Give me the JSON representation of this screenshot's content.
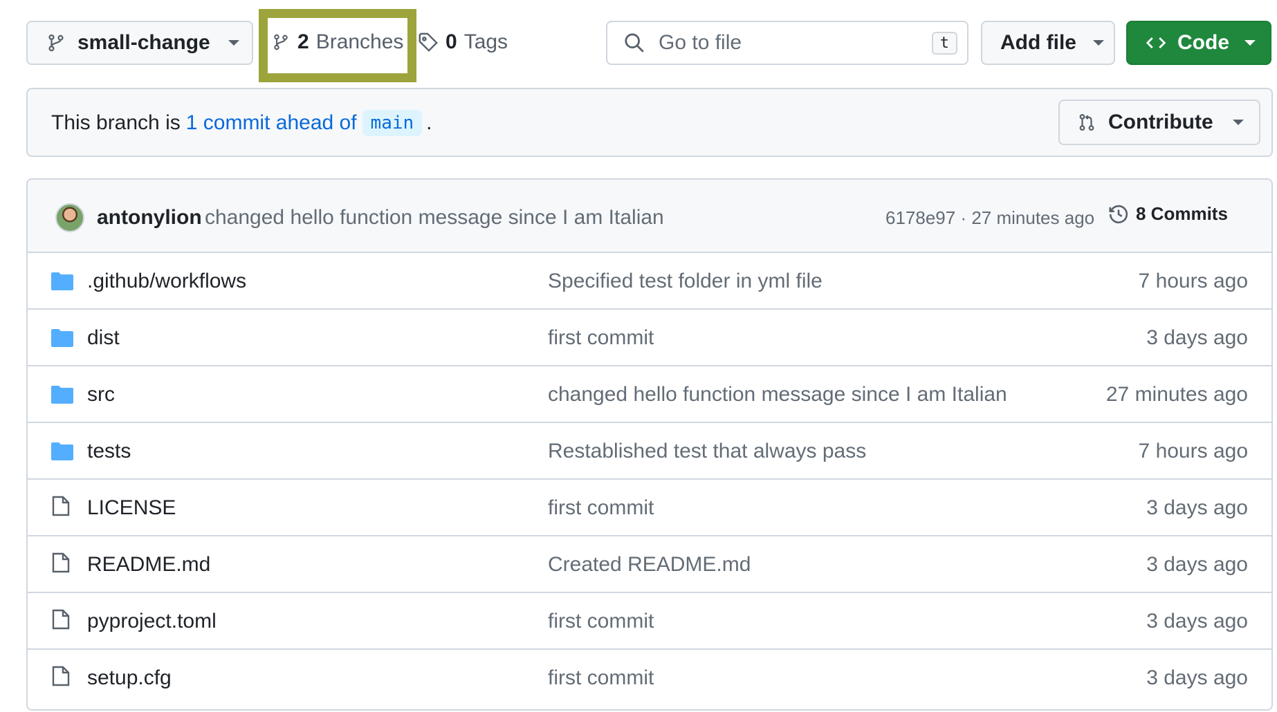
{
  "toolbar": {
    "branch_name": "small-change",
    "branches_count": "2",
    "branches_label": "Branches",
    "tags_count": "0",
    "tags_label": "Tags",
    "goto_placeholder": "Go to file",
    "goto_shortcut": "t",
    "add_file_label": "Add file",
    "code_label": "Code"
  },
  "banner": {
    "prefix": "This branch is",
    "link_text": "1 commit ahead of",
    "base_branch": "main",
    "suffix": ".",
    "contribute_label": "Contribute"
  },
  "latest_commit": {
    "author": "antonylion",
    "message": "changed hello function message since I am Italian",
    "meta": "6178e97 · 27 minutes ago",
    "commits_label": "8 Commits"
  },
  "files": [
    {
      "name": ".github/workflows",
      "type": "folder",
      "message": "Specified test folder in yml file",
      "time": "7 hours ago"
    },
    {
      "name": "dist",
      "type": "folder",
      "message": "first commit",
      "time": "3 days ago"
    },
    {
      "name": "src",
      "type": "folder",
      "message": "changed hello function message since I am Italian",
      "time": "27 minutes ago"
    },
    {
      "name": "tests",
      "type": "folder",
      "message": "Restablished test that always pass",
      "time": "7 hours ago"
    },
    {
      "name": "LICENSE",
      "type": "file",
      "message": "first commit",
      "time": "3 days ago"
    },
    {
      "name": "README.md",
      "type": "file",
      "message": "Created README.md",
      "time": "3 days ago"
    },
    {
      "name": "pyproject.toml",
      "type": "file",
      "message": "first commit",
      "time": "3 days ago"
    },
    {
      "name": "setup.cfg",
      "type": "file",
      "message": "first commit",
      "time": "3 days ago"
    }
  ],
  "colors": {
    "highlight": "#9ca43b",
    "primary_button": "#1f883d",
    "link": "#0969da",
    "folder_icon": "#54aeff"
  }
}
